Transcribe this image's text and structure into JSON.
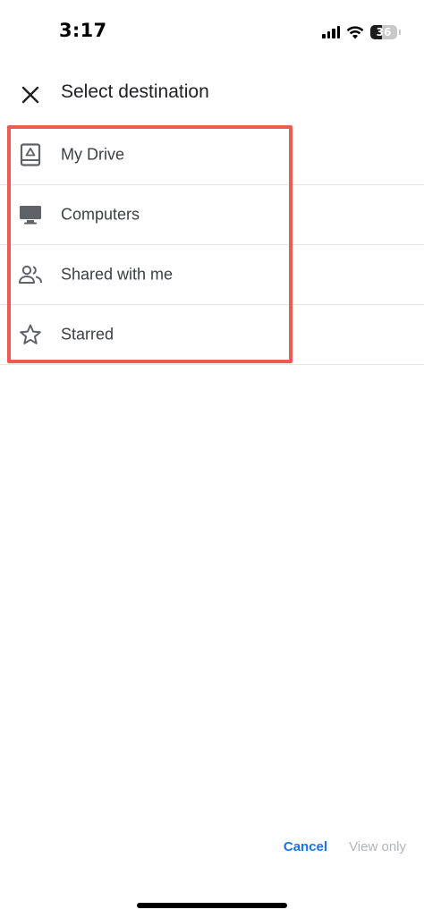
{
  "status_bar": {
    "time": "3:17",
    "battery_level": "36",
    "icons": [
      "signal-icon",
      "wifi-icon",
      "battery-icon"
    ]
  },
  "app_bar": {
    "title": "Select destination",
    "close_icon": "close-icon"
  },
  "destinations": [
    {
      "label": "My Drive",
      "icon": "my-drive-icon"
    },
    {
      "label": "Computers",
      "icon": "computer-icon"
    },
    {
      "label": "Shared with me",
      "icon": "shared-people-icon"
    },
    {
      "label": "Starred",
      "icon": "star-icon"
    }
  ],
  "actions": {
    "cancel_label": "Cancel",
    "view_only_label": "View only"
  },
  "colors": {
    "accent": "#1a73e8",
    "highlight": "#ee5b55",
    "disabled_text": "#b0b3b8",
    "icon": "#5f6368"
  }
}
